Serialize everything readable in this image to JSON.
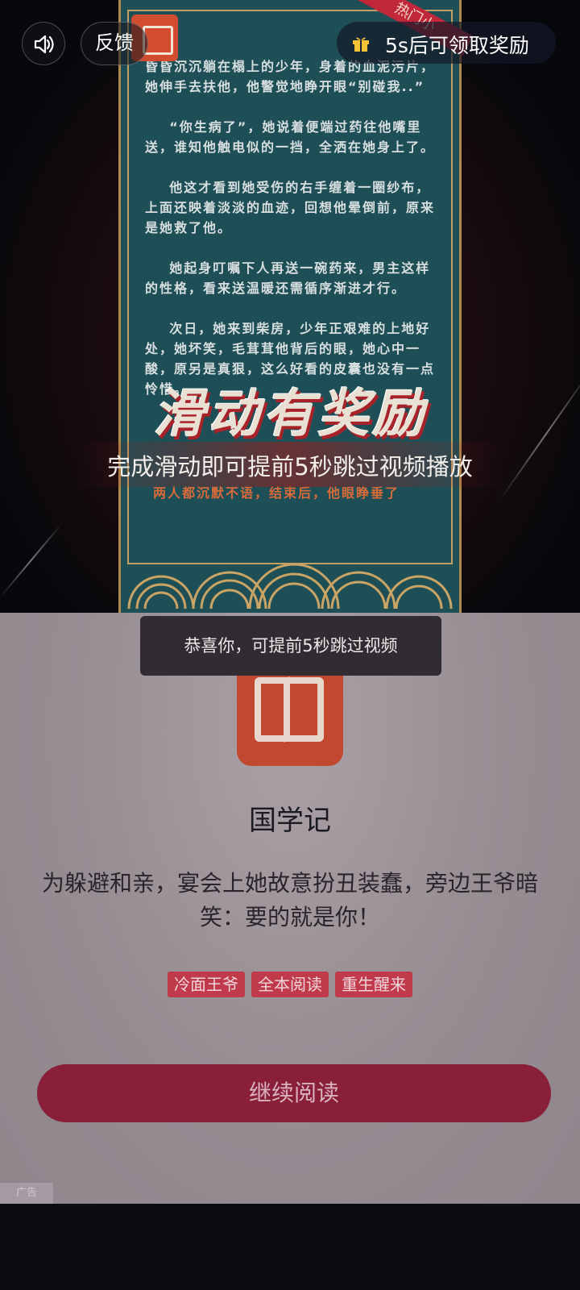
{
  "top_bar": {
    "feedback_label": "反馈",
    "reward_text": "5s后可领取奖励"
  },
  "video": {
    "hot_tag": "热门小",
    "story_text": "昏昏沉沉躺在榻上的少年，身着的血泥污片，她伸手去扶他，他警觉地睁开眼“别碰我..”\n\n    “你生病了”，她说着便端过药往他嘴里送，谁知他触电似的一挡，全洒在她身上了。\n\n    他这才看到她受伤的右手缠着一圈纱布，  上面还映着淡淡的血迹，回想他晕倒前，原来是她救了他。\n\n    她起身叮嘱下人再送一碗药来，男主这样的性格，看来送温暖还需循序渐进才行。\n\n    次日，她来到柴房，少年正艰难的上地好处，她坏笑，毛茸茸他背后的眼，她心中一酸，原另是真狠，这么好看的皮囊也没有一点怜惜。",
    "story_red": "两人都沉默不语，结束后，他眼睁垂了",
    "slogan": "滑动有奖励",
    "slogan_sub": "完成滑动即可提前5秒跳过视频播放"
  },
  "toast": "恭喜你，可提前5秒跳过视频",
  "card": {
    "app_name": "国学记",
    "description": "为躲避和亲，宴会上她故意扮丑装蠢，旁边王爷暗笑：要的就是你！",
    "tags": [
      "冷面王爷",
      "全本阅读",
      "重生醒来"
    ],
    "cta_label": "继续阅读",
    "ad_mark": "广告"
  },
  "colors": {
    "cta_bg": "#8a1f3a",
    "tag_bg": "#c13a4c",
    "panel_bg": "#1f4f56",
    "app_icon": "#c2492f"
  },
  "icons": [
    "speaker-icon",
    "gift-icon",
    "book-logo-icon"
  ]
}
